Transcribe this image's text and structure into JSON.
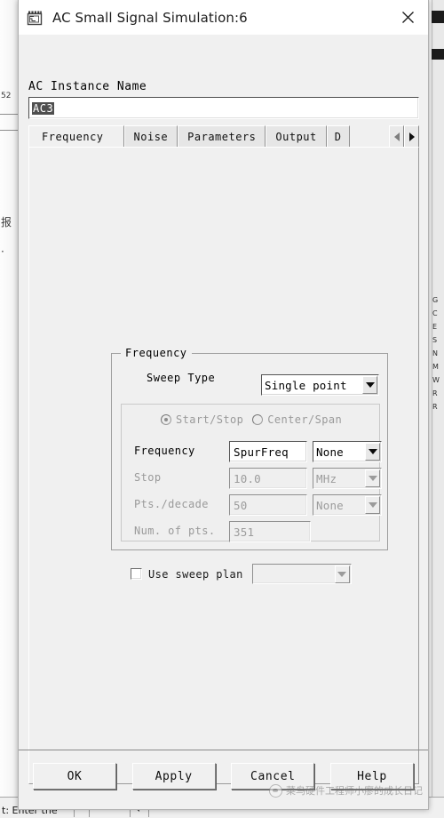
{
  "window": {
    "title": "AC Small Signal Simulation:6",
    "icon": "simulation-chip-icon",
    "close_label": "✕"
  },
  "instance": {
    "label": "AC Instance Name",
    "value": "AC3"
  },
  "tabs": [
    {
      "label": "Frequency",
      "active": true
    },
    {
      "label": "Noise",
      "active": false
    },
    {
      "label": "Parameters",
      "active": false
    },
    {
      "label": "Output",
      "active": false
    },
    {
      "label": "D",
      "active": false
    }
  ],
  "tab_scroll": {
    "left_label": "◀",
    "right_label": "▶"
  },
  "frequency_group": {
    "title": "Frequency",
    "sweep_type": {
      "label": "Sweep Type",
      "value": "Single point"
    },
    "mode_radios": [
      {
        "label": "Start/Stop",
        "selected": true
      },
      {
        "label": "Center/Span",
        "selected": false
      }
    ],
    "rows": [
      {
        "label": "Frequency",
        "value": "SpurFreq",
        "unit": "None",
        "enabled": true,
        "has_unit": true
      },
      {
        "label": "Stop",
        "value": "10.0",
        "unit": "MHz",
        "enabled": false,
        "has_unit": true
      },
      {
        "label": "Pts./decade",
        "value": "50",
        "unit": "None",
        "enabled": false,
        "has_unit": true
      },
      {
        "label": "Num. of pts.",
        "value": "351",
        "unit": "",
        "enabled": false,
        "has_unit": false
      }
    ]
  },
  "sweep_plan": {
    "label": "Use sweep plan",
    "checked": false,
    "selected": ""
  },
  "buttons": [
    {
      "label": "OK"
    },
    {
      "label": "Apply"
    },
    {
      "label": "Cancel"
    },
    {
      "label": "Help"
    }
  ],
  "watermark": {
    "text": "菜鸟硬件工程师小廖的成长日记"
  },
  "background": {
    "left_text_1": "报",
    "left_text_2": "·",
    "left_top_text": "52",
    "right_letters": "G\nC\nE\nS\nN\nM\nW\nR\nR",
    "status_text": "t: Enter the"
  },
  "colors": {
    "dialog_bg": "#f0f0f0",
    "titlebar_bg": "#ffffff",
    "field_bg": "#ffffff",
    "disabled_text": "#9c9c9c",
    "border": "#9e9e9e",
    "selection_bg": "#4f4f4f"
  }
}
